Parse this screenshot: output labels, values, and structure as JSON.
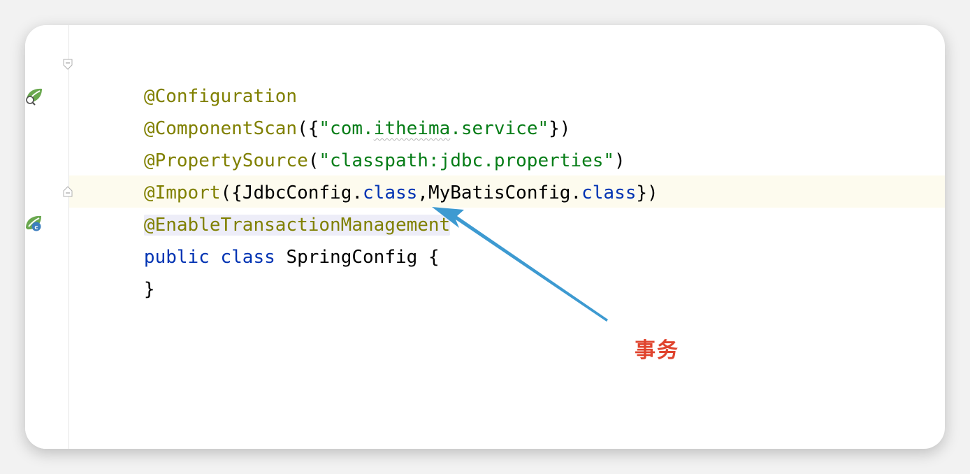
{
  "editor": {
    "lines": [
      {
        "annotation": "@Configuration"
      },
      {
        "annotation": "@ComponentScan",
        "open": "({",
        "string": "\"com.itheima.service\"",
        "close": "})",
        "squiggle_word": "itheima"
      },
      {
        "annotation": "@PropertySource",
        "open": "(",
        "string": "\"classpath:jdbc.properties\"",
        "close": ")"
      },
      {
        "annotation": "@Import",
        "open": "({",
        "class1": "JdbcConfig",
        "dot1": ".",
        "kw1": "class",
        "comma": ",",
        "class2": "MyBatisConfig",
        "dot2": ".",
        "kw2": "class",
        "close": "})"
      },
      {
        "annotation": "@EnableTransactionManagement"
      },
      {
        "kw_public": "public",
        "kw_class": "class",
        "class_name": "SpringConfig",
        "brace": "{"
      },
      {
        "brace": "}"
      }
    ]
  },
  "gutter": {
    "icons": [
      "spring-bean-search-icon",
      "spring-config-icon"
    ]
  },
  "annotation_note": {
    "label": "事务",
    "color": "#e0442e",
    "arrow_color": "#3d9ad1"
  }
}
